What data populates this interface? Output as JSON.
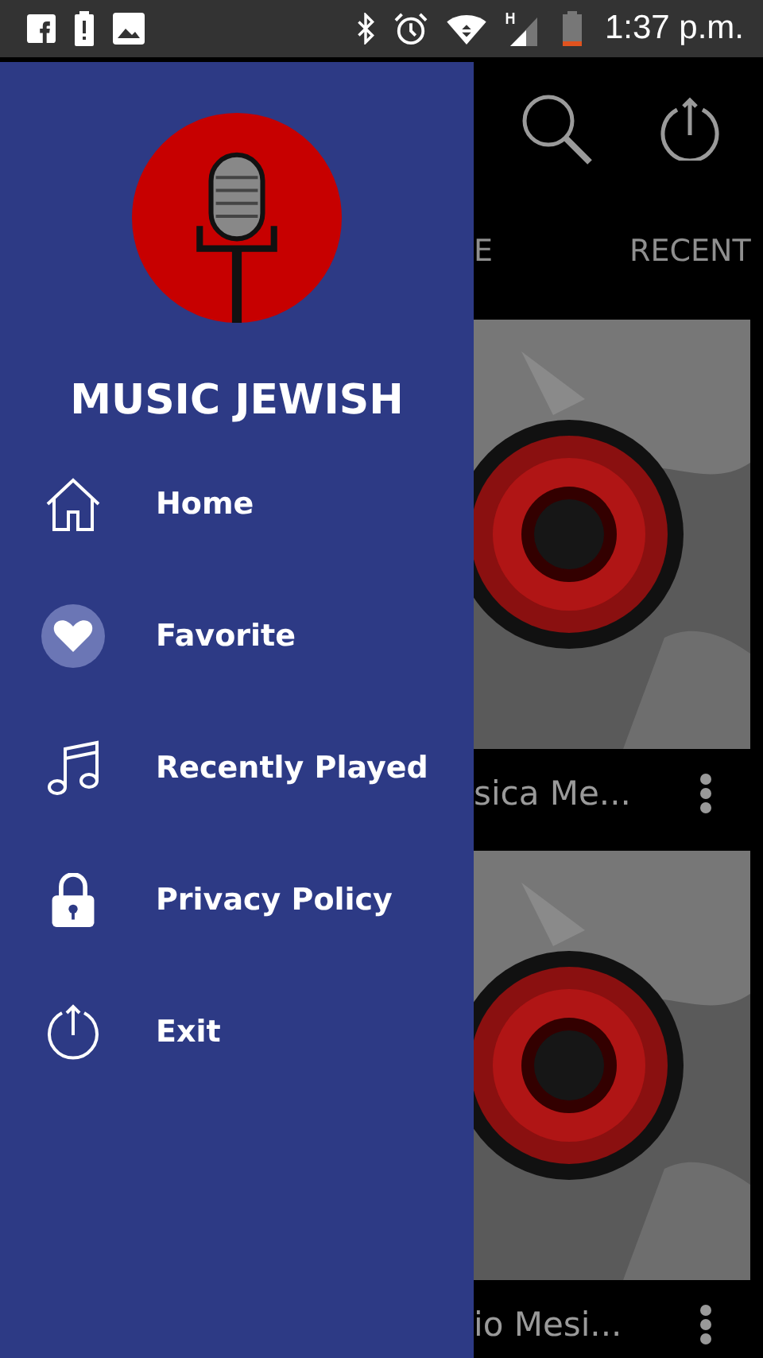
{
  "status_bar": {
    "time": "1:37 p.m."
  },
  "drawer": {
    "title": "MUSIC JEWISH",
    "items": [
      {
        "label": "Home",
        "kind": "home"
      },
      {
        "label": "Favorite",
        "kind": "heart"
      },
      {
        "label": "Recently Played",
        "kind": "music"
      },
      {
        "label": "Privacy Policy",
        "kind": "lock"
      },
      {
        "label": "Exit",
        "kind": "power"
      }
    ]
  },
  "tabs": [
    {
      "label": "E"
    },
    {
      "label": "RECENT"
    }
  ],
  "cards": [
    {
      "title": "sica Me..."
    },
    {
      "title": "io Mesi..."
    }
  ]
}
